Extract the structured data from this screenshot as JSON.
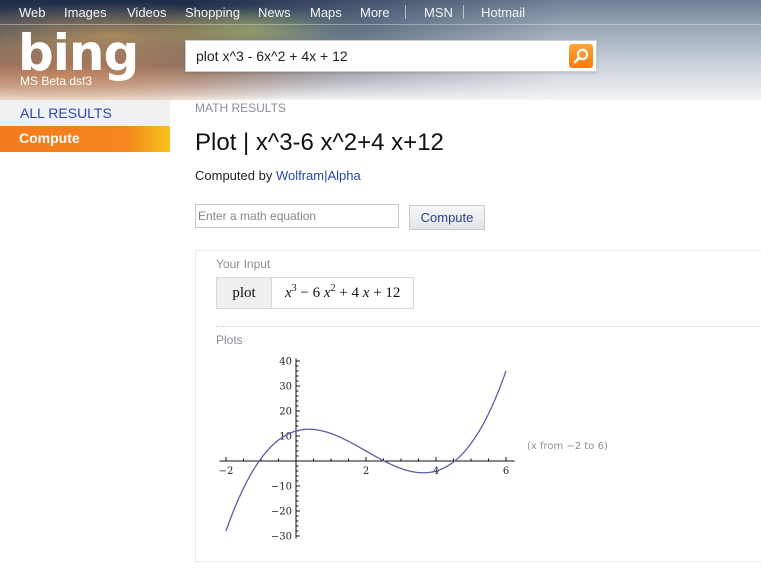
{
  "topnav": {
    "items": [
      "Web",
      "Images",
      "Videos",
      "Shopping",
      "News",
      "Maps",
      "More",
      "MSN",
      "Hotmail"
    ]
  },
  "brand": {
    "logo": "bing",
    "subtitle": "MS Beta dsf3",
    "accent_color": "#f47a1c"
  },
  "search": {
    "query": "plot x^3 - 6x^2 + 4x + 12",
    "button_icon": "search-icon"
  },
  "leftnav": {
    "all_results": "ALL RESULTS",
    "compute": "Compute"
  },
  "main": {
    "section_label": "MATH RESULTS",
    "title": "Plot | x^3-6 x^2+4 x+12",
    "computed_by_prefix": "Computed by ",
    "computed_by_link": "Wolfram|Alpha",
    "math_input_placeholder": "Enter a math equation",
    "compute_button": "Compute"
  },
  "pods": {
    "input_title": "Your Input",
    "input_command": "plot",
    "input_expression_parts": [
      "x",
      "3",
      " − 6 ",
      "x",
      "2",
      " + 4 ",
      "x",
      " + 12"
    ],
    "plots_title": "Plots",
    "range_note": "(x from −2 to 6)"
  },
  "chart_data": {
    "type": "line",
    "title": "",
    "function": "x^3 - 6x^2 + 4x + 12",
    "xlabel": "",
    "ylabel": "",
    "xlim": [
      -2.1,
      6.25
    ],
    "ylim": [
      -31,
      41
    ],
    "x_domain": [
      -2,
      6
    ],
    "x_ticks": [
      -2,
      2,
      4,
      6
    ],
    "x_tick_labels": [
      "−2",
      "2",
      "4",
      "6"
    ],
    "y_ticks": [
      -30,
      -20,
      -10,
      10,
      20,
      30,
      40
    ],
    "y_tick_labels": [
      "−30",
      "−20",
      "−10",
      "10",
      "20",
      "30",
      "40"
    ],
    "series": [
      {
        "name": "x^3 - 6x^2 + 4x + 12",
        "color": "#5b5ea6",
        "x": [
          -2,
          -1.5,
          -1,
          -0.5,
          0,
          0.35,
          0.5,
          1,
          1.5,
          2,
          2.5,
          3,
          3.5,
          3.65,
          4,
          4.5,
          5,
          5.5,
          6
        ],
        "y": [
          -28,
          -11.625,
          1,
          9.375,
          12,
          12.67,
          12.625,
          11,
          8.375,
          4,
          -1.375,
          -9,
          -4.625,
          -4.67,
          -4,
          -1.875,
          7,
          15.625,
          36
        ]
      }
    ],
    "grid": false,
    "legend": "none"
  }
}
